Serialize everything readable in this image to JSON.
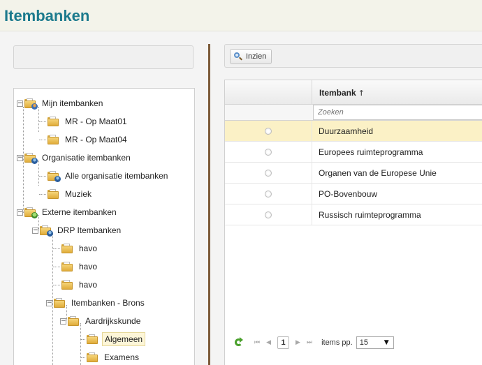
{
  "page": {
    "title": "Itembanken"
  },
  "colors": {
    "title": "#1c7a8d",
    "splitter": "#7c5b3a",
    "row_highlight": "#fbf1c6",
    "refresh": "#4aa02c"
  },
  "tree": [
    {
      "label": "Mijn itembanken",
      "icon": "folder-user-icon",
      "toggle": "−"
    },
    {
      "label": "MR - Op Maat01",
      "icon": "folder-icon"
    },
    {
      "label": "MR - Op Maat04",
      "icon": "folder-icon"
    },
    {
      "label": "Organisatie itembanken",
      "icon": "folder-org-icon",
      "toggle": "−"
    },
    {
      "label": "Alle organisatie itembanken",
      "icon": "folder-org-icon"
    },
    {
      "label": "Muziek",
      "icon": "folder-icon"
    },
    {
      "label": "Externe itembanken",
      "icon": "folder-external-icon",
      "toggle": "−"
    },
    {
      "label": "DRP Itembanken",
      "icon": "folder-org-icon",
      "toggle": "−"
    },
    {
      "label": "havo",
      "icon": "folder-icon"
    },
    {
      "label": "havo",
      "icon": "folder-icon"
    },
    {
      "label": "havo",
      "icon": "folder-icon"
    },
    {
      "label": "Itembanken - Brons",
      "icon": "folder-icon",
      "toggle": "−"
    },
    {
      "label": "Aardrijkskunde",
      "icon": "folder-icon",
      "toggle": "−"
    },
    {
      "label": "Algemeen",
      "icon": "folder-icon",
      "selected": true
    },
    {
      "label": "Examens",
      "icon": "folder-icon"
    }
  ],
  "toolbar": {
    "inzien_label": "Inzien",
    "inzien_icon": "search-icon"
  },
  "grid": {
    "column_header": "Itembank",
    "sort_indicator": "↑",
    "filter_placeholder": "Zoeken",
    "rows": [
      {
        "name": "Duurzaamheid",
        "highlighted": true
      },
      {
        "name": "Europees ruimteprogramma"
      },
      {
        "name": "Organen van de Europese Unie"
      },
      {
        "name": "PO-Bovenbouw"
      },
      {
        "name": "Russisch ruimteprogramma"
      }
    ]
  },
  "pager": {
    "refresh_icon": "refresh-icon",
    "first": "⏮",
    "prev": "◀",
    "next": "▶",
    "last": "⏭",
    "current_page": "1",
    "items_label": "items pp.",
    "items_per_page": "15",
    "caret": "▼"
  }
}
